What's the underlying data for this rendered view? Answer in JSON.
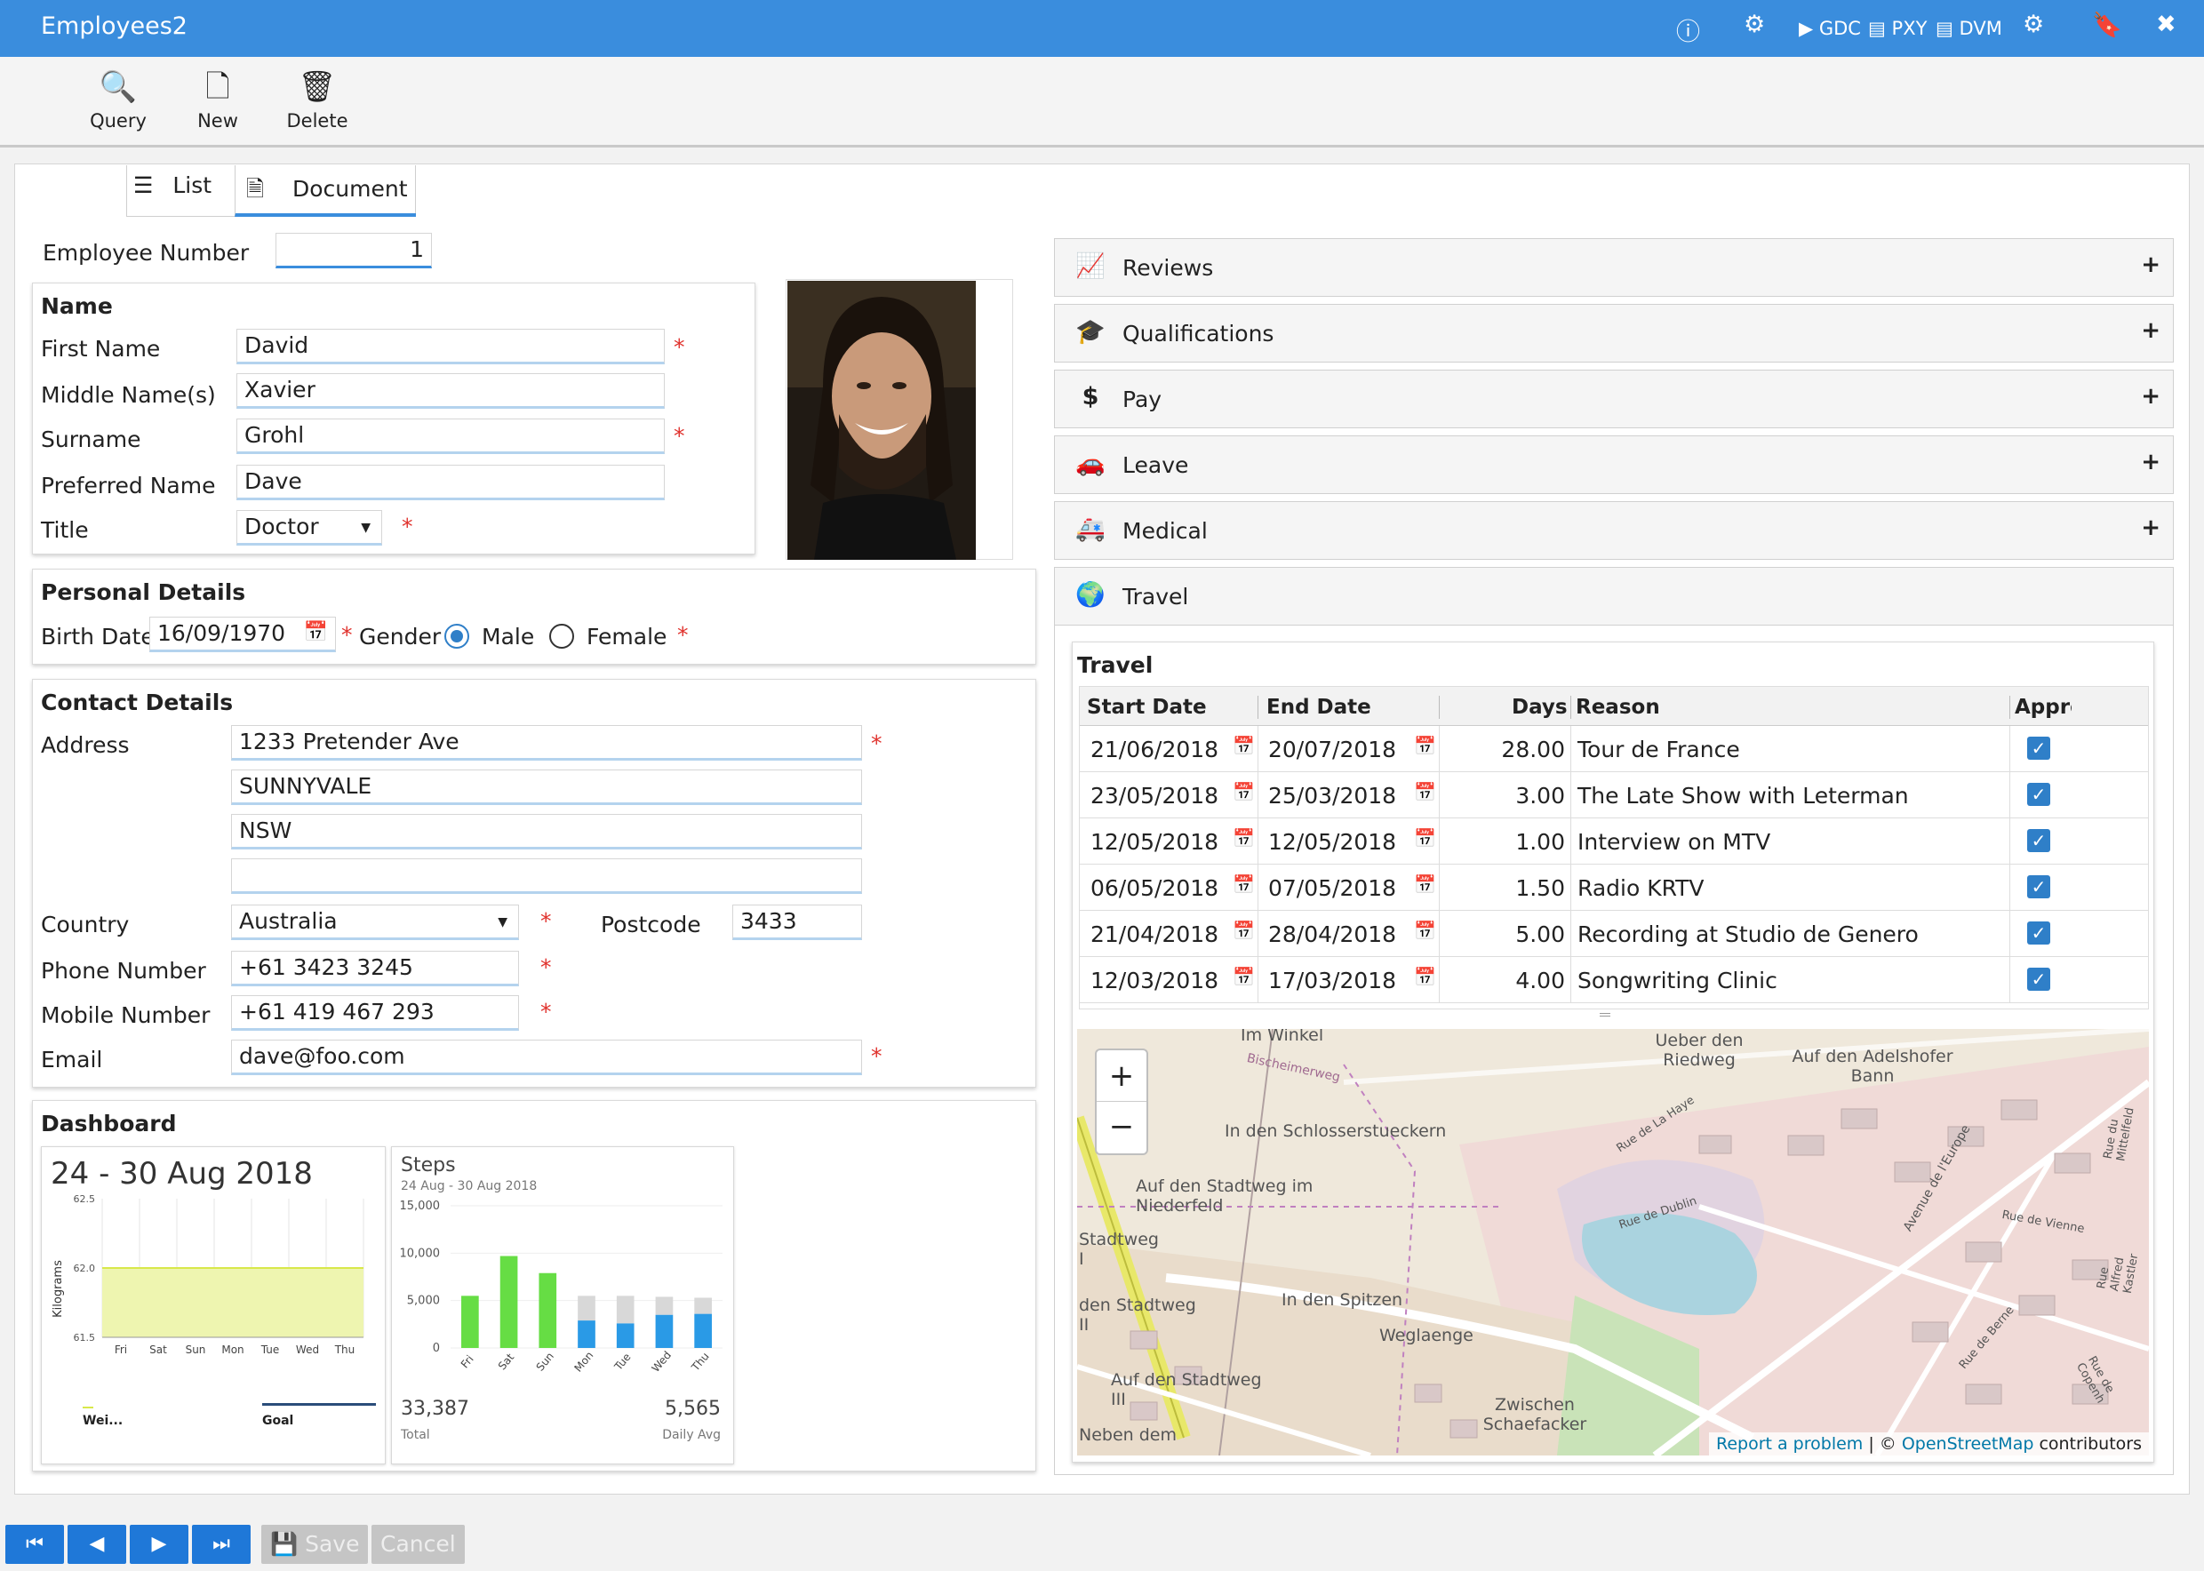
{
  "app": {
    "title": "Employees2"
  },
  "titlebar": {
    "gdc": "GDC",
    "pxy": "PXY",
    "dvm": "DVM"
  },
  "toolbar": {
    "query": "Query",
    "new": "New",
    "delete": "Delete"
  },
  "tabs": {
    "list": "List",
    "document": "Document"
  },
  "employee": {
    "number_label": "Employee Number",
    "number": "1"
  },
  "name_section": {
    "title": "Name",
    "first_label": "First Name",
    "first": "David",
    "middle_label": "Middle Name(s)",
    "middle": "Xavier",
    "surname_label": "Surname",
    "surname": "Grohl",
    "preferred_label": "Preferred Name",
    "preferred": "Dave",
    "title_label": "Title",
    "title_value": "Doctor",
    "required": "*"
  },
  "personal": {
    "title": "Personal Details",
    "birth_label": "Birth Date",
    "birth": "16/09/1970",
    "gender_label": "Gender",
    "male": "Male",
    "female": "Female",
    "gender_selected": "Male"
  },
  "contact": {
    "title": "Contact Details",
    "address_label": "Address",
    "address1": "1233  Pretender Ave",
    "address2": "SUNNYVALE",
    "address3": "NSW",
    "address4": "",
    "country_label": "Country",
    "country": "Australia",
    "postcode_label": "Postcode",
    "postcode": "3433",
    "phone_label": "Phone Number",
    "phone": "+61 3423 3245",
    "mobile_label": "Mobile Number",
    "mobile": "+61 419 467 293",
    "email_label": "Email",
    "email": "dave@foo.com"
  },
  "dashboard": {
    "title": "Dashboard",
    "weight_card": {
      "title": "24 - 30 Aug 2018",
      "ylabel": "Kilograms",
      "legend_weight": "Wei...",
      "legend_goal": "Goal"
    },
    "steps_card": {
      "title": "Steps",
      "subtitle": "24 Aug - 30 Aug 2018",
      "total": "33,387",
      "total_label": "Total",
      "avg": "5,565",
      "avg_label": "Daily Avg"
    }
  },
  "chart_data": [
    {
      "type": "area",
      "title": "24 - 30 Aug 2018",
      "ylabel": "Kilograms",
      "categories": [
        "Fri",
        "Sat",
        "Sun",
        "Mon",
        "Tue",
        "Wed",
        "Thu"
      ],
      "ylim": [
        61.5,
        62.5
      ],
      "yticks": [
        "62.5",
        "62.0",
        "61.5"
      ],
      "series": [
        {
          "name": "Wei...",
          "values": [
            null,
            null,
            null,
            null,
            null,
            null,
            null
          ]
        },
        {
          "name": "Goal",
          "values": [
            62.0,
            62.0,
            62.0,
            62.0,
            62.0,
            62.0,
            62.0
          ]
        }
      ],
      "colors": {
        "weight": "#d8e84a",
        "goal": "#2a4d7a",
        "fill": "#eef5b0"
      }
    },
    {
      "type": "bar",
      "title": "Steps",
      "subtitle": "24 Aug - 30 Aug 2018",
      "categories": [
        "Fri",
        "Sat",
        "Sun",
        "Mon",
        "Tue",
        "Wed",
        "Thu"
      ],
      "ylim": [
        0,
        15000
      ],
      "yticks": [
        "15,000",
        "10,000",
        "5,000",
        "0"
      ],
      "series": [
        {
          "name": "",
          "values": [
            5500,
            9700,
            7900,
            0,
            0,
            0,
            0
          ],
          "color": "#66dd44"
        },
        {
          "name": "",
          "values": [
            0,
            0,
            0,
            2900,
            2600,
            3500,
            3600
          ],
          "color": "#2a9ae6"
        },
        {
          "name": "",
          "values": [
            0,
            0,
            0,
            2600,
            2900,
            1900,
            1700
          ],
          "color": "#d8d8d8"
        }
      ]
    }
  ],
  "accordion": [
    {
      "label": "Reviews",
      "icon": "chart-line-icon",
      "glyph": "📈"
    },
    {
      "label": "Qualifications",
      "icon": "graduation-cap-icon",
      "glyph": "🎓"
    },
    {
      "label": "Pay",
      "icon": "dollar-icon",
      "glyph": "$"
    },
    {
      "label": "Leave",
      "icon": "car-icon",
      "glyph": "🚗"
    },
    {
      "label": "Medical",
      "icon": "ambulance-icon",
      "glyph": "🚑"
    },
    {
      "label": "Travel",
      "icon": "globe-icon",
      "glyph": "🌍"
    }
  ],
  "travel": {
    "title": "Travel",
    "headers": {
      "start": "Start Date",
      "end": "End Date",
      "days": "Days",
      "reason": "Reason",
      "approved": "Appro"
    },
    "rows": [
      {
        "start": "21/06/2018",
        "end": "20/07/2018",
        "days": "28.00",
        "reason": "Tour de France",
        "approved": true
      },
      {
        "start": "23/05/2018",
        "end": "25/03/2018",
        "days": "3.00",
        "reason": "The Late Show with Leterman",
        "approved": true
      },
      {
        "start": "12/05/2018",
        "end": "12/05/2018",
        "days": "1.00",
        "reason": "Interview on MTV",
        "approved": true
      },
      {
        "start": "06/05/2018",
        "end": "07/05/2018",
        "days": "1.50",
        "reason": "Radio KRTV",
        "approved": true
      },
      {
        "start": "21/04/2018",
        "end": "28/04/2018",
        "days": "5.00",
        "reason": "Recording at Studio de Genero",
        "approved": true
      },
      {
        "start": "12/03/2018",
        "end": "17/03/2018",
        "days": "4.00",
        "reason": "Songwriting Clinic",
        "approved": true
      }
    ]
  },
  "map": {
    "zoom_in": "+",
    "zoom_out": "−",
    "attribution_report": "Report a problem",
    "attribution_sep": " | © ",
    "attribution_osm": "OpenStreetMap",
    "attribution_tail": " contributors",
    "labels": [
      "Im Winkel",
      "Ueber den Riedweg",
      "Auf den Adelshofer Bann",
      "In den Schlosserstueckern",
      "Bischeimerweg",
      "Auf den Stadtweg im Niederfeld",
      "Stadtweg I",
      "In den Spitzen",
      "den Stadtweg II",
      "Weglaenge",
      "Auf den Stadtweg III",
      "Zwischen Schaefacker",
      "Neben dem",
      "Rue de La Haye",
      "Rue de Dublin",
      "Rue de Vienne",
      "Avenue de l'Europe",
      "Rue de Berne",
      "Rue du Mittelfeld",
      "Rue Alfred Kastler",
      "Rue de Copenh"
    ]
  },
  "footer": {
    "save": "Save",
    "cancel": "Cancel"
  },
  "colors": {
    "accent": "#3a8ddd",
    "required": "#e0322d",
    "nav": "#1f78d8"
  }
}
